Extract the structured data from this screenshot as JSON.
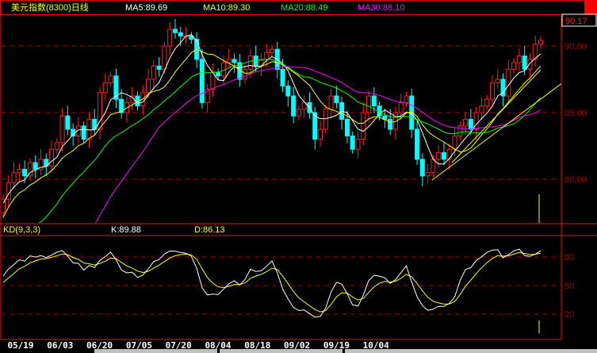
{
  "header": {
    "title": "美元指数(8300)日线",
    "ma5": "MA5:89.69",
    "ma10": "MA10:89.30",
    "ma20": "MA20:88.49",
    "ma30": "MA30:88.10"
  },
  "indicator": {
    "name": "KD(9,3,3)",
    "k": "K:89.88",
    "d": "D:86.13"
  },
  "price_axis": {
    "current": "90.17",
    "ticks": [
      {
        "value": 90,
        "label": "90.00"
      },
      {
        "value": 88,
        "label": "88.00"
      },
      {
        "value": 86,
        "label": "86.00"
      }
    ]
  },
  "kd_axis": {
    "ticks": [
      {
        "value": 80,
        "label": "80"
      },
      {
        "value": 50,
        "label": "50"
      },
      {
        "value": 20,
        "label": "20"
      }
    ]
  },
  "colors": {
    "up": "#ff2020",
    "down": "#00ffff",
    "ma5": "#ffffff",
    "ma10": "#ffff00",
    "ma20": "#00ff00",
    "ma30": "#ff00ff",
    "grid": "#a00000",
    "frame": "#ff0000"
  },
  "chart_data": {
    "type": "candlestick",
    "title": "美元指数(8300)日线",
    "ylim": [
      84.7,
      90.9
    ],
    "x_tick_labels": [
      "05/19",
      "06/03",
      "06/20",
      "07/05",
      "07/20",
      "08/04",
      "08/18",
      "09/02",
      "09/19",
      "10/04"
    ],
    "wick_extension": 0.22,
    "open": [
      85.0,
      85.4,
      85.9,
      86.2,
      86.3,
      86.1,
      86.5,
      86.3,
      86.6,
      86.4,
      86.9,
      87.1,
      87.9,
      87.5,
      87.3,
      87.6,
      87.2,
      87.8,
      87.5,
      88.6,
      88.9,
      89.1,
      88.4,
      88.0,
      88.3,
      88.5,
      88.2,
      88.6,
      89.0,
      89.4,
      89.3,
      90.0,
      90.5,
      90.4,
      90.3,
      90.3,
      90.2,
      89.6,
      88.3,
      88.7,
      89.2,
      89.1,
      89.5,
      89.6,
      89.5,
      89.0,
      89.3,
      89.7,
      89.4,
      89.6,
      89.8,
      89.9,
      89.3,
      88.8,
      88.5,
      87.9,
      88.1,
      88.3,
      88.0,
      87.2,
      87.5,
      88.1,
      88.5,
      88.3,
      87.8,
      87.3,
      86.9,
      87.2,
      88.0,
      88.5,
      88.2,
      87.9,
      87.8,
      87.5,
      88.0,
      88.3,
      88.5,
      87.5,
      86.6,
      86.1,
      86.2,
      86.6,
      86.8,
      86.6,
      86.9,
      87.3,
      87.6,
      87.8,
      87.5,
      88.0,
      88.2,
      88.4,
      88.9,
      89.0,
      88.5,
      89.3,
      89.5,
      89.7,
      89.3,
      89.6,
      90.05
    ],
    "close": [
      85.4,
      85.9,
      86.2,
      86.3,
      86.1,
      86.5,
      86.3,
      86.6,
      86.4,
      86.9,
      87.1,
      87.9,
      87.5,
      87.3,
      87.6,
      87.2,
      87.8,
      87.5,
      88.6,
      88.9,
      89.1,
      88.4,
      88.0,
      88.3,
      88.5,
      88.2,
      88.6,
      89.0,
      89.4,
      89.3,
      90.0,
      90.5,
      90.4,
      90.3,
      90.3,
      90.2,
      89.6,
      88.3,
      88.7,
      89.2,
      89.1,
      89.5,
      89.6,
      89.5,
      89.0,
      89.3,
      89.7,
      89.4,
      89.6,
      89.8,
      89.9,
      89.3,
      88.8,
      88.5,
      87.9,
      88.1,
      88.3,
      88.0,
      87.2,
      87.5,
      88.1,
      88.5,
      88.3,
      87.8,
      87.3,
      86.9,
      87.2,
      88.0,
      88.5,
      88.2,
      87.9,
      87.8,
      87.5,
      88.0,
      88.3,
      88.5,
      87.5,
      86.6,
      86.1,
      86.2,
      86.6,
      86.8,
      86.6,
      86.9,
      87.3,
      87.6,
      87.8,
      87.5,
      88.0,
      88.2,
      88.4,
      88.9,
      89.0,
      88.5,
      89.3,
      89.5,
      89.7,
      89.3,
      89.6,
      90.05,
      90.17
    ],
    "moving_averages": [
      5,
      10,
      20,
      30
    ],
    "kd_params": [
      9,
      3,
      3
    ]
  }
}
